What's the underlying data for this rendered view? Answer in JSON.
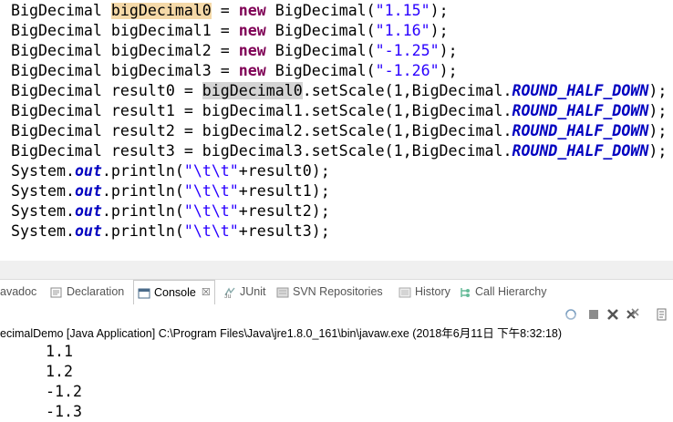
{
  "editor": {
    "lines": [
      [
        [
          "BigDecimal ",
          ""
        ],
        [
          "bigDecimal0",
          "hl-decl"
        ],
        [
          " = ",
          ""
        ],
        [
          "new",
          "kw"
        ],
        [
          " BigDecimal(",
          ""
        ],
        [
          "\"1.15\"",
          "str"
        ],
        [
          ");",
          ""
        ]
      ],
      [
        [
          "BigDecimal bigDecimal1 = ",
          ""
        ],
        [
          "new",
          "kw"
        ],
        [
          " BigDecimal(",
          ""
        ],
        [
          "\"1.16\"",
          "str"
        ],
        [
          ");",
          ""
        ]
      ],
      [
        [
          "BigDecimal bigDecimal2 = ",
          ""
        ],
        [
          "new",
          "kw"
        ],
        [
          " BigDecimal(",
          ""
        ],
        [
          "\"-1.25\"",
          "str"
        ],
        [
          ");",
          ""
        ]
      ],
      [
        [
          "BigDecimal bigDecimal3 = ",
          ""
        ],
        [
          "new",
          "kw"
        ],
        [
          " BigDecimal(",
          ""
        ],
        [
          "\"-1.26\"",
          "str"
        ],
        [
          ");",
          ""
        ]
      ],
      [
        [
          "BigDecimal result0 = ",
          ""
        ],
        [
          "bigDecimal0",
          "hl-ref"
        ],
        [
          ".setScale(1,BigDecimal.",
          ""
        ],
        [
          "ROUND_HALF_DOWN",
          "const"
        ],
        [
          ");",
          ""
        ]
      ],
      [
        [
          "BigDecimal result1 = bigDecimal1.setScale(1,BigDecimal.",
          ""
        ],
        [
          "ROUND_HALF_DOWN",
          "const"
        ],
        [
          ");",
          ""
        ]
      ],
      [
        [
          "BigDecimal result2 = bigDecimal2.setScale(1,BigDecimal.",
          ""
        ],
        [
          "ROUND_HALF_DOWN",
          "const"
        ],
        [
          ");",
          ""
        ]
      ],
      [
        [
          "BigDecimal result3 = bigDecimal3.setScale(1,BigDecimal.",
          ""
        ],
        [
          "ROUND_HALF_DOWN",
          "const"
        ],
        [
          ");",
          ""
        ]
      ],
      [
        [
          "System.",
          ""
        ],
        [
          "out",
          "field"
        ],
        [
          ".println(",
          ""
        ],
        [
          "\"\\t\\t\"",
          "str"
        ],
        [
          "+result0);",
          ""
        ]
      ],
      [
        [
          "System.",
          ""
        ],
        [
          "out",
          "field"
        ],
        [
          ".println(",
          ""
        ],
        [
          "\"\\t\\t\"",
          "str"
        ],
        [
          "+result1);",
          ""
        ]
      ],
      [
        [
          "System.",
          ""
        ],
        [
          "out",
          "field"
        ],
        [
          ".println(",
          ""
        ],
        [
          "\"\\t\\t\"",
          "str"
        ],
        [
          "+result2);",
          ""
        ]
      ],
      [
        [
          "System.",
          ""
        ],
        [
          "out",
          "field"
        ],
        [
          ".println(",
          ""
        ],
        [
          "\"\\t\\t\"",
          "str"
        ],
        [
          "+result3);",
          ""
        ]
      ]
    ]
  },
  "tabs": [
    {
      "label": "avadoc",
      "icon": "javadoc-icon",
      "name": "tab-javadoc"
    },
    {
      "label": "Declaration",
      "icon": "declaration-icon",
      "name": "tab-declaration"
    },
    {
      "label": "Console",
      "icon": "console-icon",
      "name": "tab-console",
      "active": true
    },
    {
      "label": "JUnit",
      "icon": "junit-icon",
      "name": "tab-junit"
    },
    {
      "label": "SVN Repositories",
      "icon": "svn-icon",
      "name": "tab-svn-repositories"
    },
    {
      "label": "History",
      "icon": "history-icon",
      "name": "tab-history"
    },
    {
      "label": "Call Hierarchy",
      "icon": "call-hierarchy-icon",
      "name": "tab-call-hierarchy"
    }
  ],
  "console": {
    "close_glyph": "☒",
    "launch_text": "ecimalDemo [Java Application] C:\\Program Files\\Java\\jre1.8.0_161\\bin\\javaw.exe (2018年6月11日 下午8:32:18)",
    "output": [
      "1.1",
      "1.2",
      "-1.2",
      "-1.3"
    ]
  },
  "colors": {
    "keyword": "#7f0055",
    "string": "#2a00ff",
    "static_field": "#0000c0",
    "occurrence_highlight": "#f5d9a8",
    "reference_highlight": "#d4d4d4"
  }
}
